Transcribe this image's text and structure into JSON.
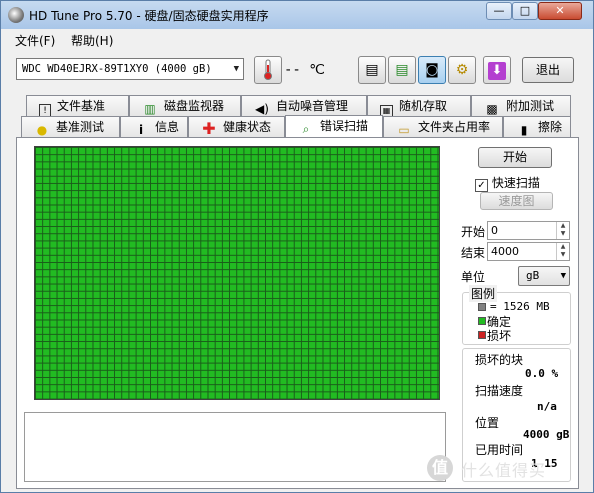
{
  "window": {
    "title": "HD Tune Pro 5.70 - 硬盘/固态硬盘实用程序",
    "buttons": {
      "minimize": "—",
      "maximize": "□",
      "close": "✕"
    }
  },
  "menu": {
    "file": "文件(F)",
    "help": "帮助(H)"
  },
  "toolbar": {
    "drive": "WDC WD40EJRX-89T1XY0 (4000 gB)",
    "temperature": "-- ℃",
    "exit_label": "退出",
    "icons": [
      "thermometer-icon",
      "copy-text-icon",
      "copy-info-icon",
      "screenshot-icon",
      "options-icon",
      "save-down-icon"
    ]
  },
  "tabs_row1": [
    {
      "label": "文件基准",
      "icon": "file-benchmark-icon"
    },
    {
      "label": "磁盘监视器",
      "icon": "disk-monitor-icon"
    },
    {
      "label": "自动噪音管理",
      "icon": "aam-speaker-icon"
    },
    {
      "label": "随机存取",
      "icon": "random-access-icon"
    },
    {
      "label": "附加测试",
      "icon": "extra-tests-icon"
    }
  ],
  "tabs_row2": [
    {
      "label": "基准测试",
      "icon": "benchmark-bulb-icon"
    },
    {
      "label": "信息",
      "icon": "info-icon"
    },
    {
      "label": "健康状态",
      "icon": "health-cross-icon"
    },
    {
      "label": "错误扫描",
      "icon": "error-scan-magnifier-icon",
      "active": true
    },
    {
      "label": "文件夹占用率",
      "icon": "folder-usage-icon"
    },
    {
      "label": "擦除",
      "icon": "erase-trash-icon"
    }
  ],
  "scan": {
    "start_button": "开始",
    "quick_scan_label": "快速扫描",
    "quick_scan_checked": true,
    "speed_map_button": "速度图",
    "start_label": "开始",
    "start_value": "0",
    "end_label": "结束",
    "end_value": "4000",
    "unit_label": "单位",
    "unit_value": "gB"
  },
  "legend": {
    "title": "图例",
    "block_size": "= 1526 MB",
    "ok_label": "确定",
    "bad_label": "损坏",
    "colors": {
      "block": "#808080",
      "ok": "#22bb22",
      "bad": "#cc2222"
    }
  },
  "stats": {
    "damaged_blocks_label": "损坏的块",
    "damaged_blocks_value": "0.0 %",
    "scan_speed_label": "扫描速度",
    "scan_speed_value": "n/a",
    "position_label": "位置",
    "position_value": "4000 gB",
    "elapsed_label": "已用时间",
    "elapsed_value": "1 15"
  },
  "watermark": {
    "badge": "值",
    "text": "什么值得买"
  }
}
